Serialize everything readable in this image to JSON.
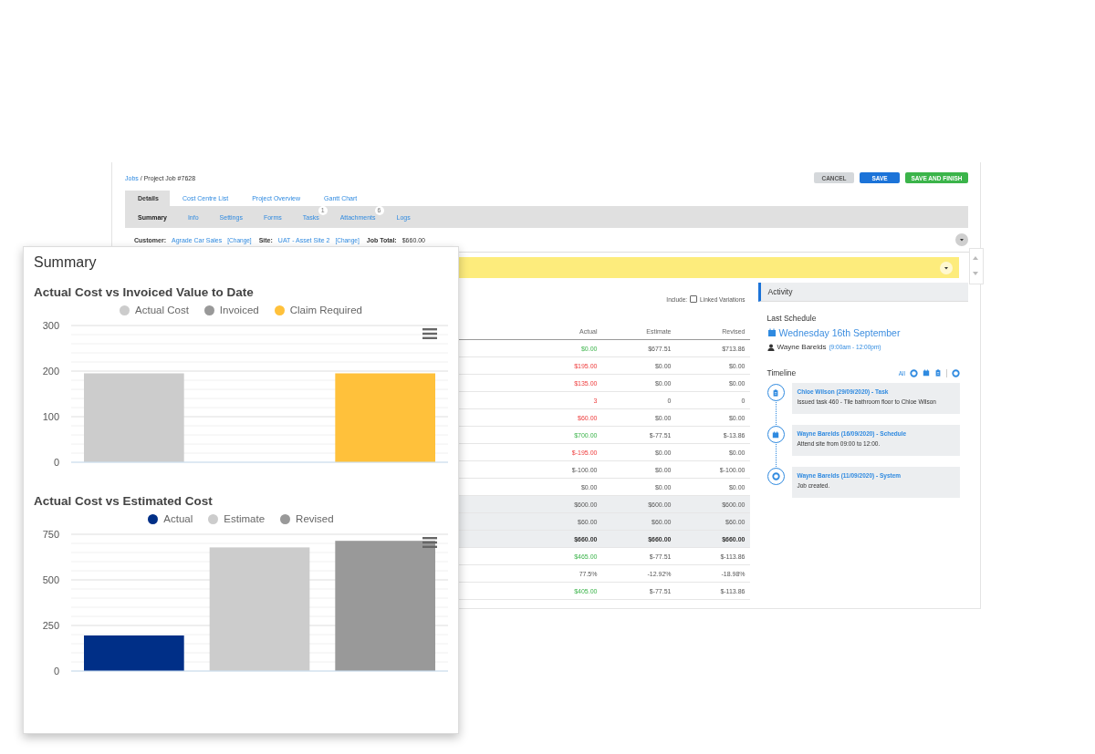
{
  "breadcrumb": {
    "link": "Jobs",
    "current": "/ Project Job #7628"
  },
  "buttons": [
    {
      "label": "CANCEL",
      "kind": "cancel"
    },
    {
      "label": "SAVE",
      "kind": "primary"
    },
    {
      "label": "SAVE AND FINISH",
      "kind": "success"
    }
  ],
  "tabs": [
    {
      "label": "Details",
      "selected": true
    },
    {
      "label": "Cost Centre List",
      "selected": false
    },
    {
      "label": "Project Overview",
      "selected": false
    },
    {
      "label": "Gantt Chart",
      "selected": false
    }
  ],
  "subtabs": [
    {
      "label": "Summary",
      "selected": true
    },
    {
      "label": "Info",
      "selected": false
    },
    {
      "label": "Settings",
      "selected": false
    },
    {
      "label": "Forms",
      "selected": false
    },
    {
      "label": "Tasks",
      "selected": false,
      "badge": "1"
    },
    {
      "label": "Attachments",
      "selected": false,
      "badge": "6"
    },
    {
      "label": "Logs",
      "selected": false
    }
  ],
  "job_info": [
    {
      "label": "Customer:",
      "value": "Agrade Car Sales",
      "change": "[Change]"
    },
    {
      "label": "Site:",
      "value": "UAT - Asset Site 2",
      "change": "[Change]"
    },
    {
      "label": "Job Total:",
      "value": "$660.00"
    }
  ],
  "include": {
    "label": "Include:",
    "option": "Linked Variations",
    "checked": false
  },
  "table": {
    "columns": [
      "Actual",
      "Estimate",
      "Revised"
    ],
    "rows": [
      {
        "actual": "$0.00",
        "kind": "gain",
        "estimate": "$677.51",
        "revised": "$713.86",
        "shaded": false,
        "bold": false
      },
      {
        "actual": "$195.00",
        "kind": "loss",
        "estimate": "$0.00",
        "revised": "$0.00",
        "shaded": false,
        "bold": false
      },
      {
        "actual": "$135.00",
        "kind": "loss",
        "estimate": "$0.00",
        "revised": "$0.00",
        "shaded": false,
        "bold": false
      },
      {
        "actual": "3",
        "kind": "loss",
        "estimate": "0",
        "revised": "0",
        "shaded": false,
        "bold": false
      },
      {
        "actual": "$60.00",
        "kind": "loss",
        "estimate": "$0.00",
        "revised": "$0.00",
        "shaded": false,
        "bold": false
      },
      {
        "actual": "$700.00",
        "kind": "gain",
        "estimate": "$-77.51",
        "revised": "$-13.86",
        "shaded": false,
        "bold": false
      },
      {
        "actual": "$-195.00",
        "kind": "loss",
        "estimate": "$0.00",
        "revised": "$0.00",
        "shaded": false,
        "bold": false
      },
      {
        "actual": "$-100.00",
        "kind": "plain",
        "estimate": "$0.00",
        "revised": "$-100.00",
        "shaded": false,
        "bold": false
      },
      {
        "actual": "$0.00",
        "kind": "plain",
        "estimate": "$0.00",
        "revised": "$0.00",
        "shaded": false,
        "bold": false
      },
      {
        "actual": "$600.00",
        "kind": "plain",
        "estimate": "$600.00",
        "revised": "$600.00",
        "shaded": true,
        "bold": false
      },
      {
        "actual": "$60.00",
        "kind": "plain",
        "estimate": "$60.00",
        "revised": "$60.00",
        "shaded": true,
        "bold": false
      },
      {
        "actual": "$660.00",
        "kind": "plain",
        "estimate": "$660.00",
        "revised": "$660.00",
        "shaded": true,
        "bold": true
      },
      {
        "actual": "$465.00",
        "kind": "gain",
        "estimate": "$-77.51",
        "revised": "$-113.86",
        "shaded": false,
        "bold": false
      },
      {
        "actual": "77.5%",
        "kind": "plain",
        "estimate": "-12.92%",
        "revised": "-18.98%",
        "shaded": false,
        "bold": false
      },
      {
        "actual": "$405.00",
        "kind": "gain",
        "estimate": "$-77.51",
        "revised": "$-113.86",
        "shaded": false,
        "bold": false
      }
    ]
  },
  "activity": {
    "title": "Activity",
    "last_schedule_label": "Last Schedule",
    "date": "Wednesday 16th September",
    "person": "Wayne Barelds",
    "time": "(9:00am - 12:00pm)",
    "timeline_label": "Timeline",
    "filter_all": "All",
    "entries": [
      {
        "kind": "task",
        "title": "Chloe Wilson (29/09/2020) - Task",
        "text": "Issued task 460 - Tile bathroom floor to Chloe Wilson"
      },
      {
        "kind": "schedule",
        "title": "Wayne Barelds (16/09/2020) - Schedule",
        "text": "Attend site from 09:00 to 12:00."
      },
      {
        "kind": "system",
        "title": "Wayne Barelds (11/09/2020) - System",
        "text": "Job created."
      }
    ]
  },
  "summary": {
    "title": "Summary",
    "charts": [
      {
        "chart_data": {
          "type": "bar",
          "title": "Actual Cost vs Invoiced Value to Date",
          "ylim": [
            0,
            300
          ],
          "yticks": [
            0,
            100,
            200,
            300
          ],
          "series": [
            {
              "name": "Actual Cost",
              "color": "#cccccc",
              "values": [
                195
              ]
            },
            {
              "name": "Invoiced",
              "color": "#999999",
              "values": [
                0
              ]
            },
            {
              "name": "Claim Required",
              "color": "#ffc13b",
              "values": [
                195
              ]
            }
          ]
        }
      },
      {
        "chart_data": {
          "type": "bar",
          "title": "Actual Cost vs Estimated Cost",
          "ylim": [
            0,
            750
          ],
          "yticks": [
            0,
            250,
            500,
            750
          ],
          "series": [
            {
              "name": "Actual",
              "color": "#002f87",
              "values": [
                195
              ]
            },
            {
              "name": "Estimate",
              "color": "#cccccc",
              "values": [
                678
              ]
            },
            {
              "name": "Revised",
              "color": "#999999",
              "values": [
                714
              ]
            }
          ]
        }
      }
    ]
  }
}
